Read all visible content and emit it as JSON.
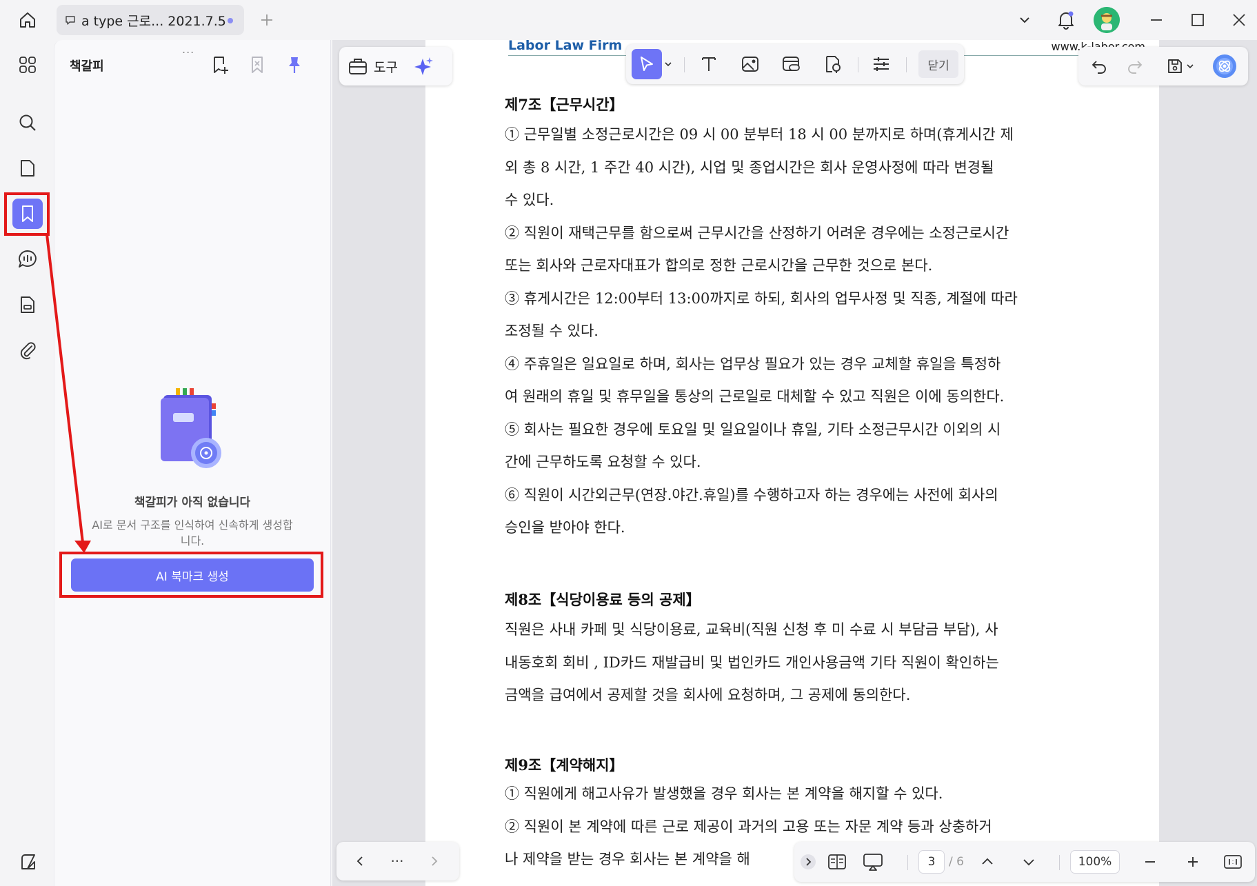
{
  "titlebar": {
    "tab_title": "a type 근로... 2021.7.5"
  },
  "panel": {
    "title": "책갈피",
    "handle": "...",
    "empty_title": "책갈피가 아직 없습니다",
    "empty_desc": "AI로 문서 구조를 인식하여 신속하게 생성합니다.",
    "ai_button": "AI 북마크 생성"
  },
  "tools": {
    "label": "도구"
  },
  "edit_toolbar": {
    "close_label": "닫기"
  },
  "document": {
    "header_left": "Labor Law Firm",
    "header_right": "www.k-labor.com",
    "article7_title": "제7조【근무시간】",
    "article7": [
      "① 근무일별 소정근로시간은 09 시 00 분부터 18 시 00 분까지로 하며(휴게시간 제",
      "외 총 8 시간, 1 주간 40 시간), 시업 및 종업시간은 회사 운영사정에 따라 변경될",
      "수 있다.",
      "② 직원이 재택근무를 함으로써 근무시간을 산정하기 어려운 경우에는 소정근로시간",
      "또는 회사와 근로자대표가 합의로 정한 근로시간을 근무한 것으로 본다.",
      "③ 휴게시간은 12:00부터 13:00까지로 하되, 회사의 업무사정 및 직종, 계절에 따라",
      "조정될 수 있다.",
      "④ 주휴일은 일요일로 하며, 회사는 업무상 필요가 있는 경우 교체할 휴일을 특정하",
      "여 원래의 휴일 및 휴무일을 통상의 근로일로 대체할 수 있고 직원은 이에 동의한다.",
      "⑤ 회사는 필요한 경우에 토요일 및 일요일이나 휴일, 기타 소정근무시간 이외의 시",
      "간에 근무하도록 요청할 수 있다.",
      "⑥ 직원이 시간외근무(연장.야간.휴일)를 수행하고자 하는 경우에는 사전에 회사의",
      "승인을 받아야 한다."
    ],
    "article8_title": "제8조【식당이용료 등의 공제】",
    "article8": [
      "직원은 사내 카페 및 식당이용료, 교육비(직원 신청 후 미 수료 시 부담금 부담), 사",
      "내동호회 회비 , ID카드 재발급비 및 법인카드 개인사용금액 기타 직원이 확인하는",
      "금액을 급여에서 공제할 것을 회사에 요청하며, 그 공제에 동의한다."
    ],
    "article9_title": "제9조【계약해지】",
    "article9": [
      "① 직원에게 해고사유가 발생했을 경우 회사는 본 계약을 해지할 수 있다.",
      "② 직원이 본 계약에 따른 근로 제공이 과거의 고용 또는 자문 계약 등과 상충하거",
      "나 제약을 받는 경우 회사는 본 계약을 해"
    ]
  },
  "pager": {
    "more": "···"
  },
  "bottom_bar": {
    "current_page": "3",
    "total_pages": "/ 6",
    "zoom": "100%"
  },
  "colors": {
    "accent": "#6e74f6",
    "annotation": "#e31919",
    "header_blue": "#1d5ea8"
  }
}
